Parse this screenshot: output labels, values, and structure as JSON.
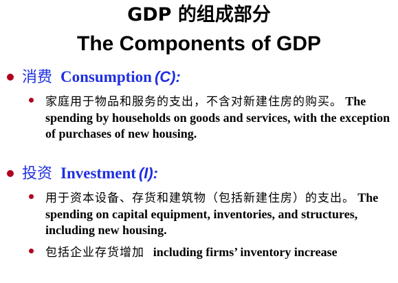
{
  "title": {
    "chinese": "GDP 的组成部分",
    "english": "The Components of GDP"
  },
  "sections": [
    {
      "label_zh": "消费",
      "label_en": "Consumption",
      "symbol": "(C):",
      "items": [
        {
          "text_zh": "家庭用于物品和服务的支出，不含对新建住房的购买。",
          "text_en": "The spending by households on goods and services, with the exception of purchases of new housing."
        }
      ]
    },
    {
      "label_zh": "投资",
      "label_en": "Investment",
      "symbol": "(I):",
      "items": [
        {
          "text_zh": "用于资本设备、存货和建筑物（包括新建住房）的支出。",
          "text_en": "The spending on capital equipment, inventories, and structures, including new housing."
        },
        {
          "text_zh": "包括企业存货增加",
          "text_en": "including firms’ inventory increase"
        }
      ]
    }
  ],
  "colors": {
    "heading": "#1f2fe0",
    "bullet": "#b00020",
    "text": "#000000"
  }
}
